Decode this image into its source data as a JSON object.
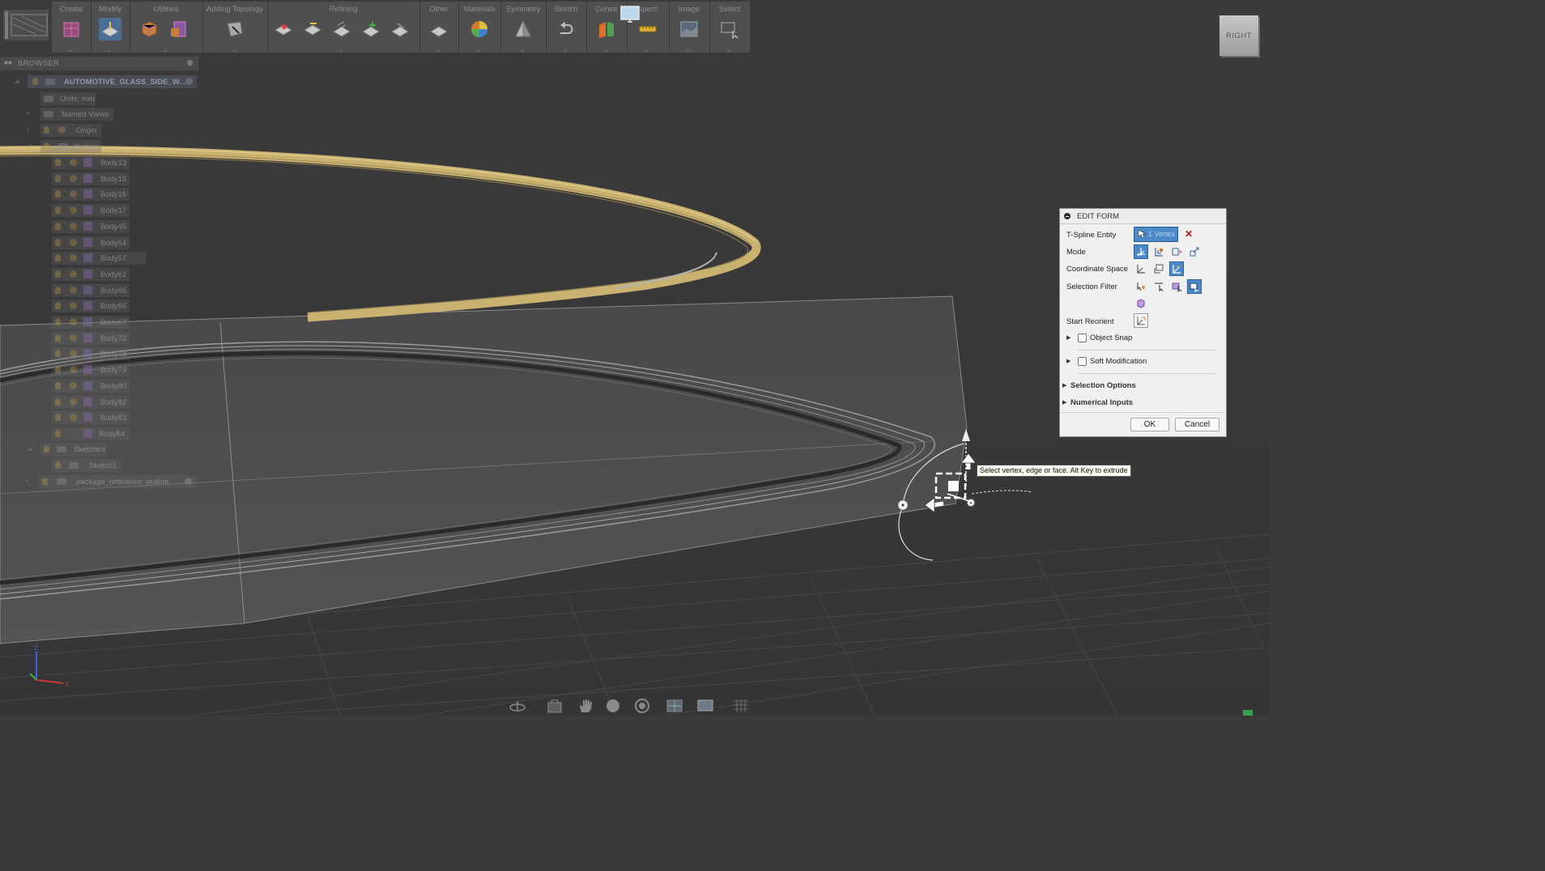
{
  "toolbar": {
    "groups": [
      {
        "label": "Create"
      },
      {
        "label": "Modify"
      },
      {
        "label": "Utilities"
      },
      {
        "label": "Adding Topology"
      },
      {
        "label": "Refining"
      },
      {
        "label": "Other"
      },
      {
        "label": "Materials"
      },
      {
        "label": "Symmetry"
      },
      {
        "label": "Sketch"
      },
      {
        "label": "Constr"
      },
      {
        "label": "spect"
      },
      {
        "label": "Image"
      },
      {
        "label": "Select"
      }
    ]
  },
  "browser": {
    "title": "BROWSER",
    "root": "AUTOMOTIVE_GLASS_SIDE_W...",
    "units": "Units: mm",
    "named_views": "Named Views",
    "origin": "Origin",
    "bodies_folder": "Bodies",
    "bodies": [
      "Body13",
      "Body15",
      "Body16",
      "Body17",
      "Body45",
      "Body54",
      "Body57",
      "Body62",
      "Body65",
      "Body66",
      "Body67",
      "Body72",
      "Body78",
      "Body79",
      "Body80",
      "Body82",
      "Body83",
      "Body84"
    ],
    "sketches_folder": "Sketches",
    "sketch": "Sketch1",
    "component": "package_reference_outline"
  },
  "viewcube": {
    "face": "RIGHT"
  },
  "edit_form": {
    "title": "EDIT FORM",
    "tspline_entity_label": "T-Spline Entity",
    "tspline_entity_value": "1 Vertex",
    "mode_label": "Mode",
    "coord_label": "Coordinate Space",
    "filter_label": "Selection Filter",
    "reorient_label": "Start Reorient",
    "object_snap": "Object Snap",
    "soft_mod": "Soft Modification",
    "selection_options": "Selection Options",
    "numerical_inputs": "Numerical Inputs",
    "ok": "OK",
    "cancel": "Cancel"
  },
  "tooltip": "Select vertex, edge or face. Alt Key to extrude",
  "axes": {
    "z": "Z",
    "x": "X"
  },
  "colors": {
    "background": "#3a3a3a",
    "accent": "#4c89c8",
    "rail_yellow": "#c9b270",
    "panel": "#f0f0f0"
  },
  "icons": {
    "nav": [
      "orbit-icon",
      "look-at-icon",
      "pan-icon",
      "zoom-icon",
      "fit-icon",
      "display-settings-icon",
      "screen-icon",
      "grid-icon"
    ]
  }
}
